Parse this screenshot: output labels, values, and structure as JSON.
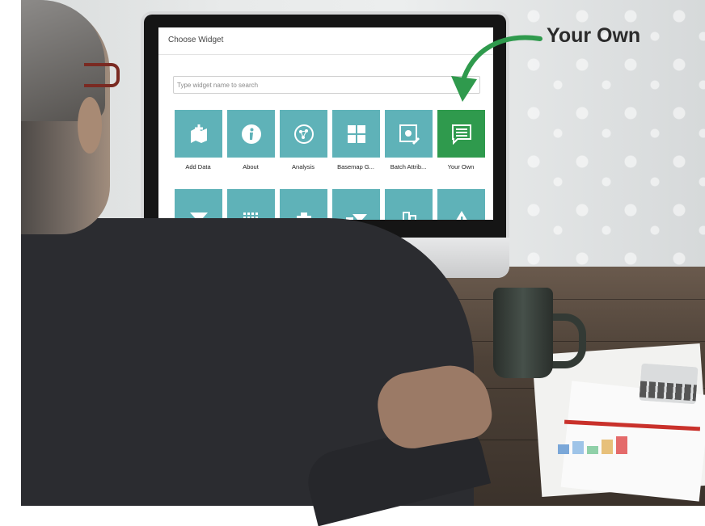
{
  "dialog": {
    "title": "Choose Widget",
    "search_placeholder": "Type widget name to search"
  },
  "widgets": [
    {
      "label": "Add Data",
      "icon": "add-data-icon",
      "selected": false
    },
    {
      "label": "About",
      "icon": "info-icon",
      "selected": false
    },
    {
      "label": "Analysis",
      "icon": "analysis-icon",
      "selected": false
    },
    {
      "label": "Basemap G...",
      "icon": "basemap-gallery-icon",
      "selected": false
    },
    {
      "label": "Batch Attrib...",
      "icon": "batch-attribute-icon",
      "selected": false
    },
    {
      "label": "Your Own",
      "icon": "list-icon",
      "selected": true
    },
    {
      "label": "",
      "icon": "filter-icon",
      "selected": false
    },
    {
      "label": "",
      "icon": "grid-dots-icon",
      "selected": false
    },
    {
      "label": "",
      "icon": "clipboard-icon",
      "selected": false
    },
    {
      "label": "",
      "icon": "filter-layers-icon",
      "selected": false
    },
    {
      "label": "",
      "icon": "city-icon",
      "selected": false
    },
    {
      "label": "",
      "icon": "warning-icon",
      "selected": false
    }
  ],
  "callout": {
    "text": "Your Own",
    "color": "#2b2b2b",
    "arrow_color": "#2f9a4d"
  },
  "colors": {
    "tile": "#5fb2b8",
    "tile_selected": "#2f9a4d"
  }
}
